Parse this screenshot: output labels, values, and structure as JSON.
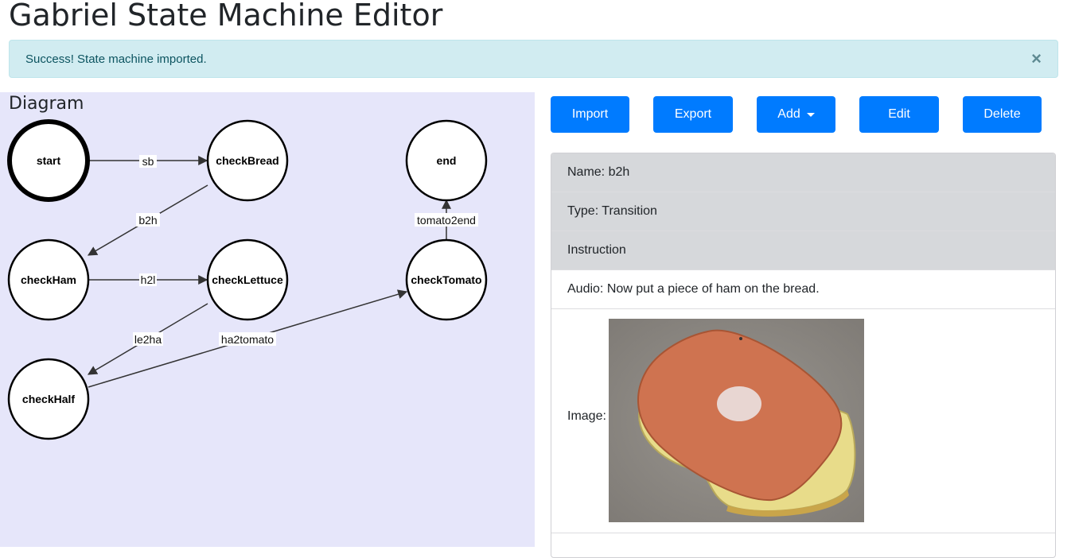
{
  "page_title": "Gabriel State Machine Editor",
  "alert": {
    "message": "Success! State machine imported.",
    "close_symbol": "×"
  },
  "diagram": {
    "title": "Diagram",
    "nodes": {
      "start": "start",
      "checkBread": "checkBread",
      "end": "end",
      "checkHam": "checkHam",
      "checkLettuce": "checkLettuce",
      "checkTomato": "checkTomato",
      "checkHalf": "checkHalf"
    },
    "edges": {
      "sb": "sb",
      "b2h": "b2h",
      "h2l": "h2l",
      "le2ha": "le2ha",
      "ha2tomato": "ha2tomato",
      "tomato2end": "tomato2end"
    }
  },
  "toolbar": {
    "import": "Import",
    "export": "Export",
    "add": "Add",
    "edit": "Edit",
    "delete": "Delete"
  },
  "details": {
    "name": "Name: b2h",
    "type": "Type: Transition",
    "instruction": "Instruction",
    "audio": "Audio: Now put a piece of ham on the bread.",
    "image_label": "Image:"
  },
  "colors": {
    "primary": "#007bff",
    "alert_bg": "#d1ecf1",
    "alert_text": "#0c5460",
    "diagram_bg": "#e6e6fa",
    "gray_row": "#d6d8db"
  }
}
